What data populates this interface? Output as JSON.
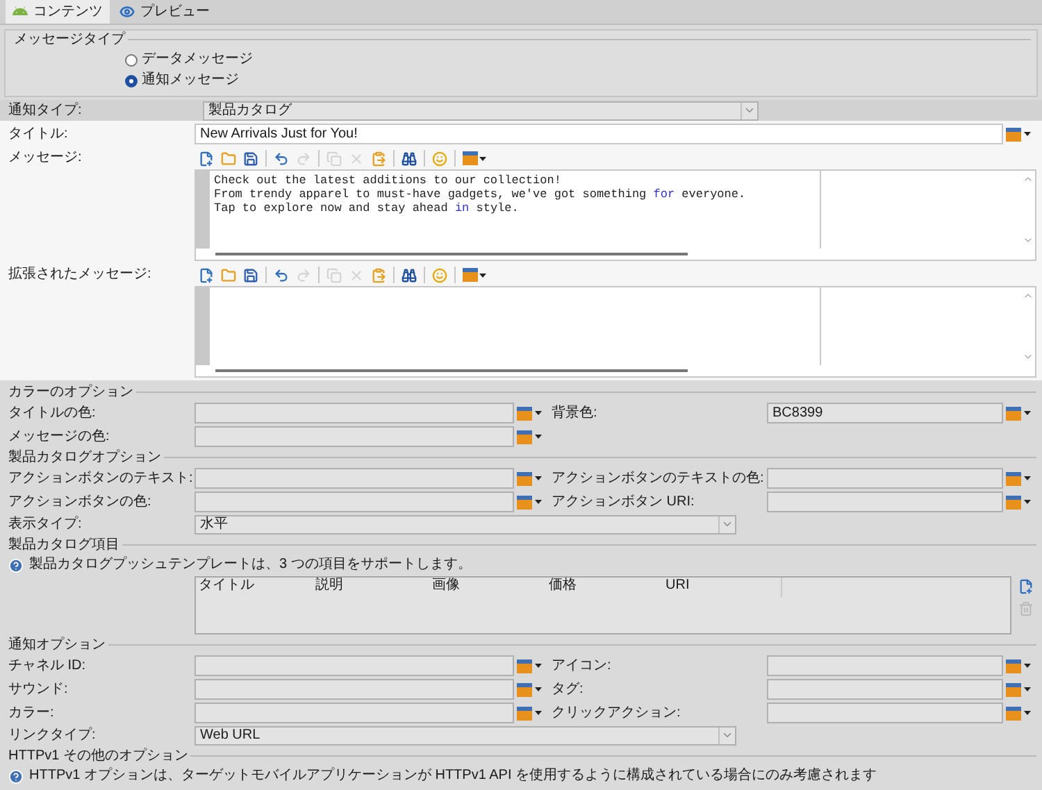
{
  "tabs": [
    {
      "label": "コンテンツ",
      "selected": true,
      "kind": "android"
    },
    {
      "label": "プレビュー",
      "selected": false,
      "kind": "eye"
    }
  ],
  "message_type": {
    "legend": "メッセージタイプ",
    "options": [
      {
        "label": "データメッセージ",
        "selected": false
      },
      {
        "label": "通知メッセージ",
        "selected": true
      }
    ]
  },
  "notification_type": {
    "label": "通知タイプ:",
    "value": "製品カタログ"
  },
  "title": {
    "label": "タイトル:",
    "value": "New Arrivals Just for You!"
  },
  "message": {
    "label": "メッセージ:",
    "toolbar": [
      {
        "kind": "insert",
        "disabled": false
      },
      {
        "kind": "open",
        "disabled": false
      },
      {
        "kind": "save",
        "disabled": false
      },
      {
        "kind": "separator"
      },
      {
        "kind": "undo",
        "disabled": false
      },
      {
        "kind": "redo",
        "disabled": true
      },
      {
        "kind": "separator"
      },
      {
        "kind": "copy",
        "disabled": true
      },
      {
        "kind": "cut",
        "disabled": true
      },
      {
        "kind": "paste",
        "disabled": false
      },
      {
        "kind": "separator"
      },
      {
        "kind": "find",
        "disabled": false
      },
      {
        "kind": "separator"
      },
      {
        "kind": "emoji",
        "disabled": false
      },
      {
        "kind": "separator"
      },
      {
        "kind": "panel",
        "disabled": false
      }
    ],
    "lines": [
      [
        {
          "text": "Check out the latest additions to our collection!",
          "keyword": false
        }
      ],
      [
        {
          "text": "From trendy apparel to must-have gadgets, we've got something ",
          "keyword": false
        },
        {
          "text": "for",
          "keyword": true
        },
        {
          "text": " everyone.",
          "keyword": false
        }
      ],
      [
        {
          "text": "Tap to explore now and stay ahead ",
          "keyword": false
        },
        {
          "text": "in",
          "keyword": true
        },
        {
          "text": " style.",
          "keyword": false
        }
      ]
    ]
  },
  "extended_message": {
    "label": "拡張されたメッセージ:",
    "toolbar": [
      {
        "kind": "insert",
        "disabled": false
      },
      {
        "kind": "open",
        "disabled": false
      },
      {
        "kind": "save",
        "disabled": false
      },
      {
        "kind": "separator"
      },
      {
        "kind": "undo",
        "disabled": false
      },
      {
        "kind": "redo",
        "disabled": true
      },
      {
        "kind": "separator"
      },
      {
        "kind": "copy",
        "disabled": true
      },
      {
        "kind": "cut",
        "disabled": true
      },
      {
        "kind": "paste",
        "disabled": false
      },
      {
        "kind": "separator"
      },
      {
        "kind": "find",
        "disabled": false
      },
      {
        "kind": "separator"
      },
      {
        "kind": "emoji",
        "disabled": false
      },
      {
        "kind": "separator"
      },
      {
        "kind": "panel",
        "disabled": false
      }
    ]
  },
  "color_options": {
    "legend": "カラーのオプション",
    "rows": [
      {
        "left": {
          "label": "タイトルの色:"
        },
        "right": {
          "label": "背景色:",
          "value": "BC8399"
        }
      },
      {
        "left": {
          "label": "メッセージの色:"
        }
      }
    ]
  },
  "catalog_options": {
    "legend": "製品カタログオプション",
    "rows": [
      {
        "left": {
          "label": "アクションボタンのテキスト:"
        },
        "right": {
          "label": "アクションボタンのテキストの色:"
        }
      },
      {
        "left": {
          "label": "アクションボタンの色:"
        },
        "right": {
          "label": "アクションボタン URI:"
        }
      }
    ],
    "select": {
      "label": "表示タイプ:",
      "value": "水平"
    }
  },
  "catalog_items": {
    "legend": "製品カタログ項目",
    "info": "製品カタログプッシュテンプレートは、3 つの項目をサポートします。",
    "columns": [
      "タイトル",
      "説明",
      "画像",
      "価格",
      "URI"
    ]
  },
  "notification_options": {
    "legend": "通知オプション",
    "rows": [
      {
        "left": {
          "label": "チャネル ID:"
        },
        "right": {
          "label": "アイコン:"
        }
      },
      {
        "left": {
          "label": "サウンド:"
        },
        "right": {
          "label": "タグ:"
        }
      },
      {
        "left": {
          "label": "カラー:"
        },
        "right": {
          "label": "クリックアクション:"
        }
      }
    ],
    "select": {
      "label": "リンクタイプ:",
      "value": "Web URL"
    }
  },
  "httpv1": {
    "legend": "HTTPv1 その他のオプション",
    "info": "HTTPv1 オプションは、ターゲットモバイルアプリケーションが HTTPv1 API を使用するように構成されている場合にのみ考慮されます"
  }
}
